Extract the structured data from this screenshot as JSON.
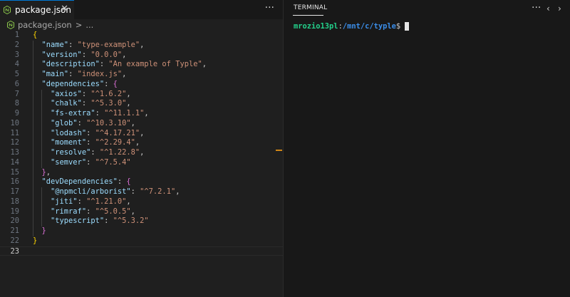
{
  "editor": {
    "tab": {
      "label": "package.json",
      "close_icon": "close-icon",
      "file_icon": "nodejs-icon"
    },
    "more_icon": "ellipsis-icon",
    "breadcrumb": {
      "file": "package.json",
      "separator": ">",
      "symbol": "..."
    },
    "current_line": 23,
    "lines": [
      {
        "num": "1",
        "tokens": [
          [
            "b",
            "{"
          ]
        ]
      },
      {
        "num": "2",
        "tokens": [
          [
            "s",
            "  "
          ],
          [
            "k",
            "\"name\""
          ],
          [
            "p",
            ": "
          ],
          [
            "v",
            "\"type-example\""
          ],
          [
            "p",
            ","
          ]
        ]
      },
      {
        "num": "3",
        "tokens": [
          [
            "s",
            "  "
          ],
          [
            "k",
            "\"version\""
          ],
          [
            "p",
            ": "
          ],
          [
            "v",
            "\"0.0.0\""
          ],
          [
            "p",
            ","
          ]
        ]
      },
      {
        "num": "4",
        "tokens": [
          [
            "s",
            "  "
          ],
          [
            "k",
            "\"description\""
          ],
          [
            "p",
            ": "
          ],
          [
            "v",
            "\"An example of Typle\""
          ],
          [
            "p",
            ","
          ]
        ]
      },
      {
        "num": "5",
        "tokens": [
          [
            "s",
            "  "
          ],
          [
            "k",
            "\"main\""
          ],
          [
            "p",
            ": "
          ],
          [
            "v",
            "\"index.js\""
          ],
          [
            "p",
            ","
          ]
        ]
      },
      {
        "num": "6",
        "tokens": [
          [
            "s",
            "  "
          ],
          [
            "k",
            "\"dependencies\""
          ],
          [
            "p",
            ": "
          ],
          [
            "b2",
            "{"
          ]
        ]
      },
      {
        "num": "7",
        "tokens": [
          [
            "s",
            "    "
          ],
          [
            "k",
            "\"axios\""
          ],
          [
            "p",
            ": "
          ],
          [
            "v",
            "\"^1.6.2\""
          ],
          [
            "p",
            ","
          ]
        ]
      },
      {
        "num": "8",
        "tokens": [
          [
            "s",
            "    "
          ],
          [
            "k",
            "\"chalk\""
          ],
          [
            "p",
            ": "
          ],
          [
            "v",
            "\"^5.3.0\""
          ],
          [
            "p",
            ","
          ]
        ]
      },
      {
        "num": "9",
        "tokens": [
          [
            "s",
            "    "
          ],
          [
            "k",
            "\"fs-extra\""
          ],
          [
            "p",
            ": "
          ],
          [
            "v",
            "\"^11.1.1\""
          ],
          [
            "p",
            ","
          ]
        ]
      },
      {
        "num": "10",
        "tokens": [
          [
            "s",
            "    "
          ],
          [
            "k",
            "\"glob\""
          ],
          [
            "p",
            ": "
          ],
          [
            "v",
            "\"^10.3.10\""
          ],
          [
            "p",
            ","
          ]
        ]
      },
      {
        "num": "11",
        "tokens": [
          [
            "s",
            "    "
          ],
          [
            "k",
            "\"lodash\""
          ],
          [
            "p",
            ": "
          ],
          [
            "v",
            "\"^4.17.21\""
          ],
          [
            "p",
            ","
          ]
        ]
      },
      {
        "num": "12",
        "tokens": [
          [
            "s",
            "    "
          ],
          [
            "k",
            "\"moment\""
          ],
          [
            "p",
            ": "
          ],
          [
            "v",
            "\"^2.29.4\""
          ],
          [
            "p",
            ","
          ]
        ]
      },
      {
        "num": "13",
        "tokens": [
          [
            "s",
            "    "
          ],
          [
            "k",
            "\"resolve\""
          ],
          [
            "p",
            ": "
          ],
          [
            "v",
            "\"^1.22.8\""
          ],
          [
            "p",
            ","
          ]
        ]
      },
      {
        "num": "14",
        "tokens": [
          [
            "s",
            "    "
          ],
          [
            "k",
            "\"semver\""
          ],
          [
            "p",
            ": "
          ],
          [
            "v",
            "\"^7.5.4\""
          ]
        ]
      },
      {
        "num": "15",
        "tokens": [
          [
            "s",
            "  "
          ],
          [
            "b2",
            "}"
          ],
          [
            "p",
            ","
          ]
        ]
      },
      {
        "num": "16",
        "tokens": [
          [
            "s",
            "  "
          ],
          [
            "k",
            "\"devDependencies\""
          ],
          [
            "p",
            ": "
          ],
          [
            "b2",
            "{"
          ]
        ]
      },
      {
        "num": "17",
        "tokens": [
          [
            "s",
            "    "
          ],
          [
            "k",
            "\"@npmcli/arborist\""
          ],
          [
            "p",
            ": "
          ],
          [
            "v",
            "\"^7.2.1\""
          ],
          [
            "p",
            ","
          ]
        ]
      },
      {
        "num": "18",
        "tokens": [
          [
            "s",
            "    "
          ],
          [
            "k",
            "\"jiti\""
          ],
          [
            "p",
            ": "
          ],
          [
            "v",
            "\"^1.21.0\""
          ],
          [
            "p",
            ","
          ]
        ]
      },
      {
        "num": "19",
        "tokens": [
          [
            "s",
            "    "
          ],
          [
            "k",
            "\"rimraf\""
          ],
          [
            "p",
            ": "
          ],
          [
            "v",
            "\"^5.0.5\""
          ],
          [
            "p",
            ","
          ]
        ]
      },
      {
        "num": "20",
        "tokens": [
          [
            "s",
            "    "
          ],
          [
            "k",
            "\"typescript\""
          ],
          [
            "p",
            ": "
          ],
          [
            "v",
            "\"^5.3.2\""
          ]
        ]
      },
      {
        "num": "21",
        "tokens": [
          [
            "s",
            "  "
          ],
          [
            "b2",
            "}"
          ]
        ]
      },
      {
        "num": "22",
        "tokens": [
          [
            "b",
            "}"
          ]
        ]
      },
      {
        "num": "23",
        "tokens": []
      }
    ]
  },
  "terminal": {
    "tab_label": "TERMINAL",
    "more_icon": "ellipsis-icon",
    "prev_icon": "chevron-left-icon",
    "next_icon": "chevron-right-icon",
    "prompt": {
      "user_host": "mrozio13pl",
      "colon": ":",
      "path": "/mnt/c/typle",
      "symbol": "$"
    }
  },
  "colors": {
    "editor_bg": "#1f1f1f",
    "terminal_bg": "#181818",
    "key": "#9cdcfe",
    "string": "#ce9178",
    "brace": "#ffd700",
    "brace_nested": "#da70d6",
    "prompt_user": "#23d18b",
    "prompt_path": "#3b8eea",
    "tab_accent": "#0078d4"
  }
}
